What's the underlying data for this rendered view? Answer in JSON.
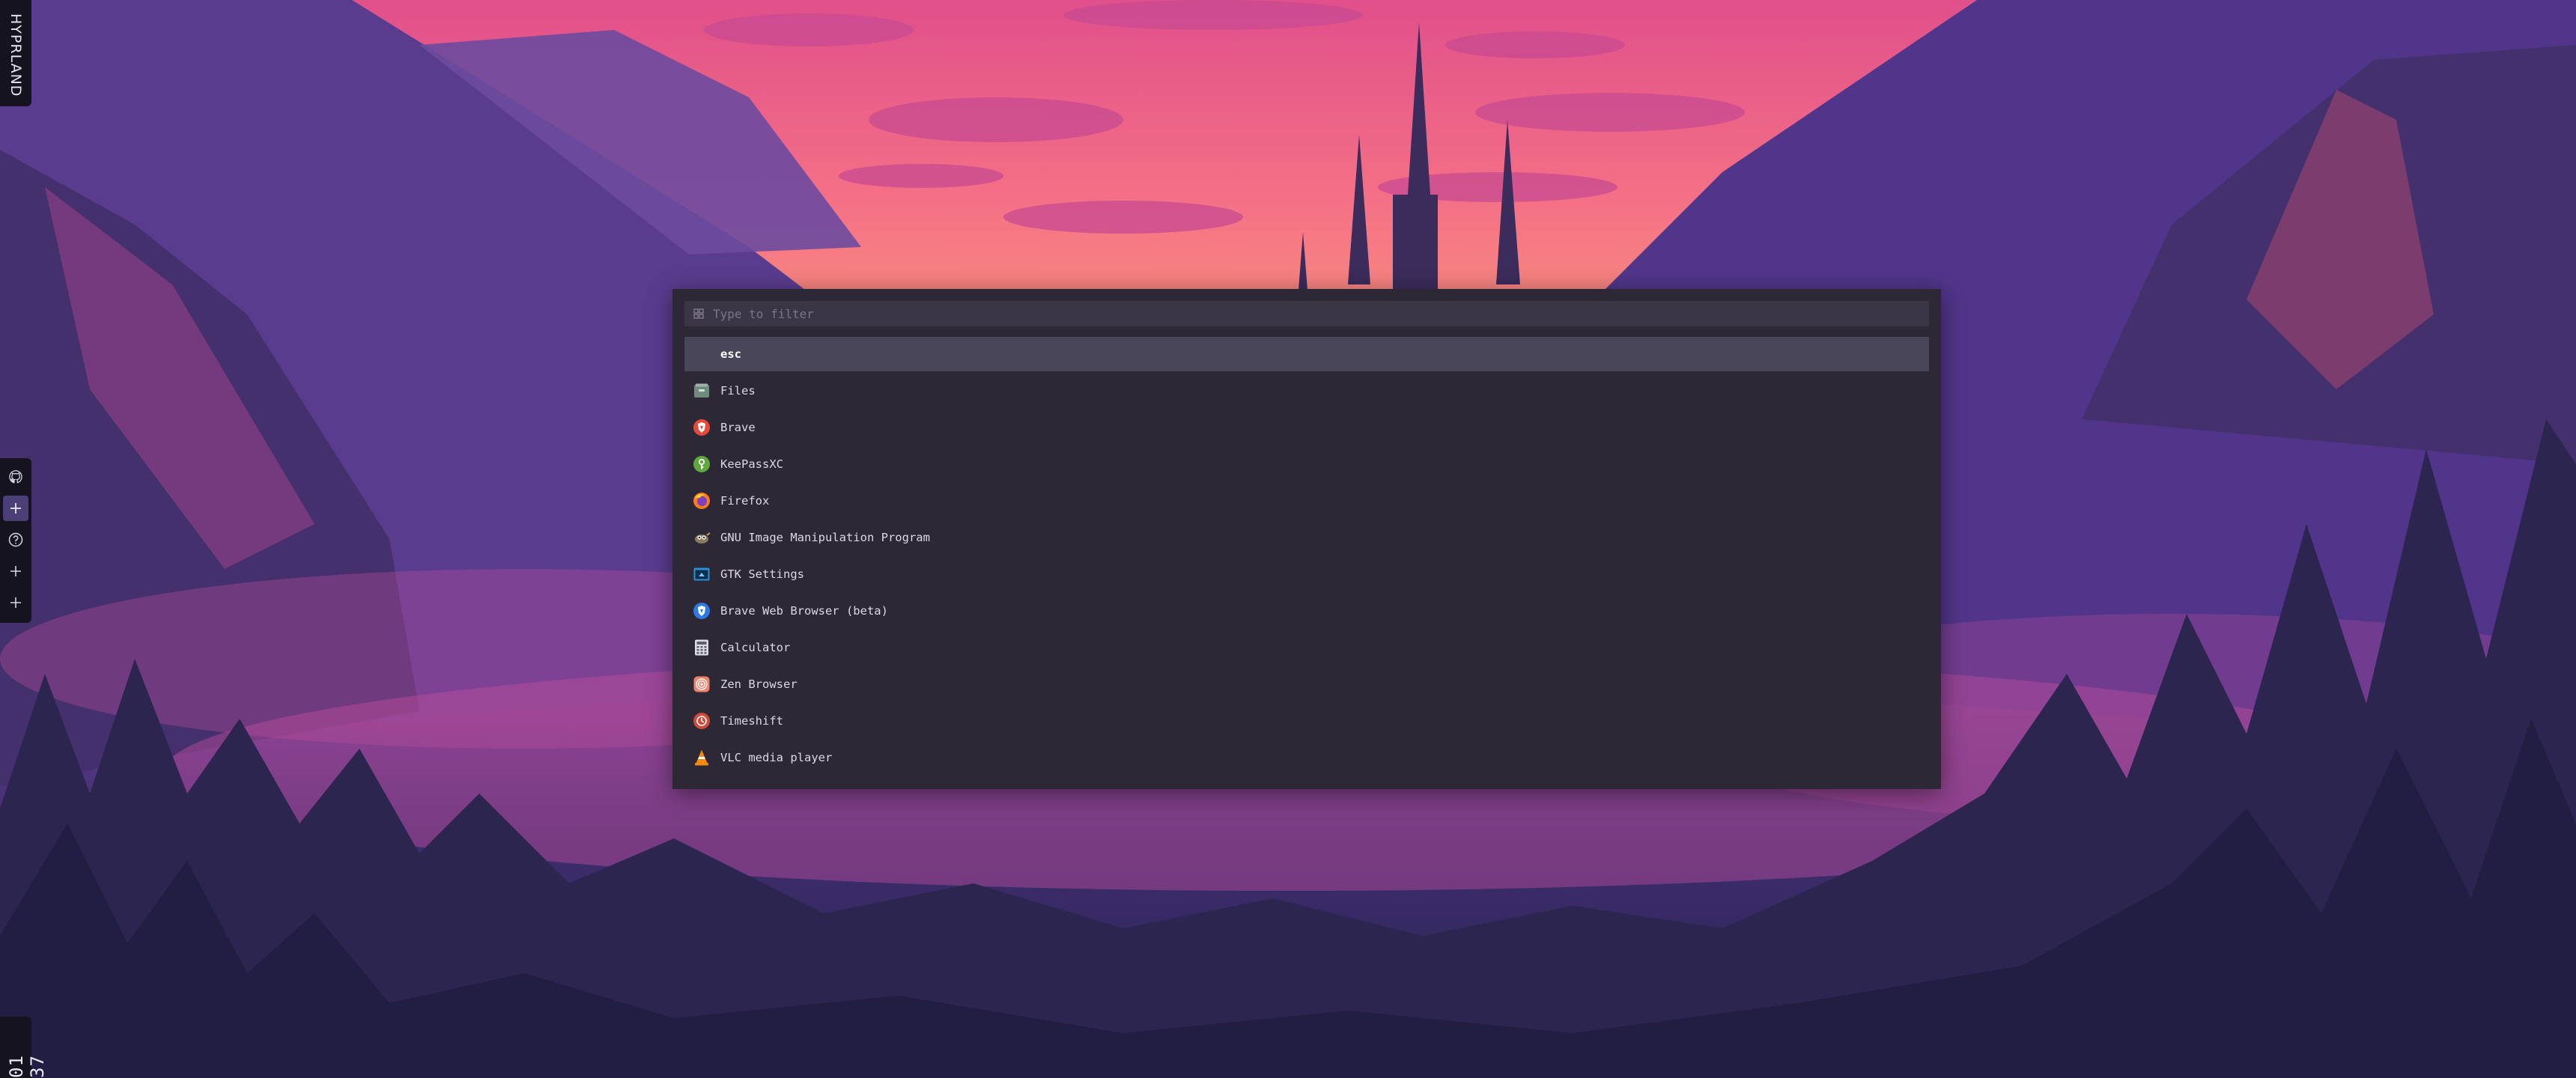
{
  "topbar": {
    "brand": "HYPRLAND",
    "clock": "01 37"
  },
  "dock": {
    "items": [
      {
        "icon": "github-icon"
      },
      {
        "icon": "plus-icon",
        "active": true
      },
      {
        "icon": "help-circle-icon"
      },
      {
        "icon": "plus-icon"
      },
      {
        "icon": "plus-icon"
      }
    ]
  },
  "launcher": {
    "search": {
      "value": "",
      "placeholder": "Type to filter",
      "icon": "grid-icon"
    },
    "items": [
      {
        "label": "esc",
        "icon": "none",
        "selected": true
      },
      {
        "label": "Files",
        "icon": "file-manager-icon"
      },
      {
        "label": "Brave",
        "icon": "brave-icon"
      },
      {
        "label": "KeePassXC",
        "icon": "keepassxc-icon"
      },
      {
        "label": "Firefox",
        "icon": "firefox-icon"
      },
      {
        "label": "GNU Image Manipulation Program",
        "icon": "gimp-icon"
      },
      {
        "label": "GTK Settings",
        "icon": "gtk-settings-icon"
      },
      {
        "label": "Brave Web Browser (beta)",
        "icon": "brave-beta-icon"
      },
      {
        "label": "Calculator",
        "icon": "calculator-icon"
      },
      {
        "label": "Zen Browser",
        "icon": "zen-browser-icon"
      },
      {
        "label": "Timeshift",
        "icon": "timeshift-icon"
      },
      {
        "label": "VLC media player",
        "icon": "vlc-icon"
      }
    ]
  },
  "colors": {
    "launcher_bg": "#2c2836",
    "search_bg": "#3a3646",
    "selected_bg": "#4a4659",
    "bar_bg": "#151320",
    "dock_active": "#4b3f78"
  }
}
